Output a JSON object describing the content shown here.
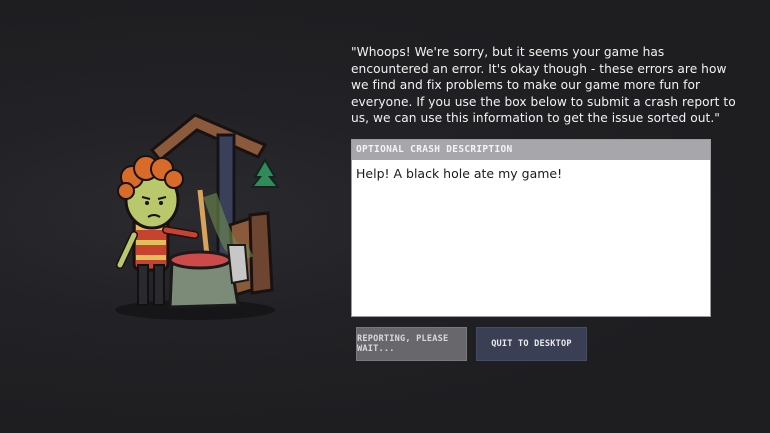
{
  "dialog": {
    "message": "\"Whoops! We're sorry, but it seems your game has encountered an error. It's okay though - these errors are how we find and fix problems to make our game more fun for everyone. If you use the box below to submit a crash report to us, we can use this information to get the issue sorted out.\"",
    "message_lines": [
      "\"Whoops! We're sorry, but it seems your game has",
      "encountered an error. It's okay though - these errors are how",
      "we find and fix problems to make our game more fun for",
      "everyone. If you use the box below to submit a crash report to",
      "us, we can use this information to get the issue sorted out.\""
    ]
  },
  "crash_description": {
    "header": "OPTIONAL CRASH DESCRIPTION",
    "value": "Help! A black hole ate my game!"
  },
  "buttons": {
    "report_label": "REPORTING, PLEASE WAIT...",
    "quit_label": "QUIT TO DESKTOP"
  },
  "illustration": {
    "icon": "duplicant-mop-bucket-illustration"
  },
  "colors": {
    "background": "#1f1f22",
    "panel_header": "#a6a6ab",
    "report_button": "#68686c",
    "quit_button": "#3a3f54"
  }
}
